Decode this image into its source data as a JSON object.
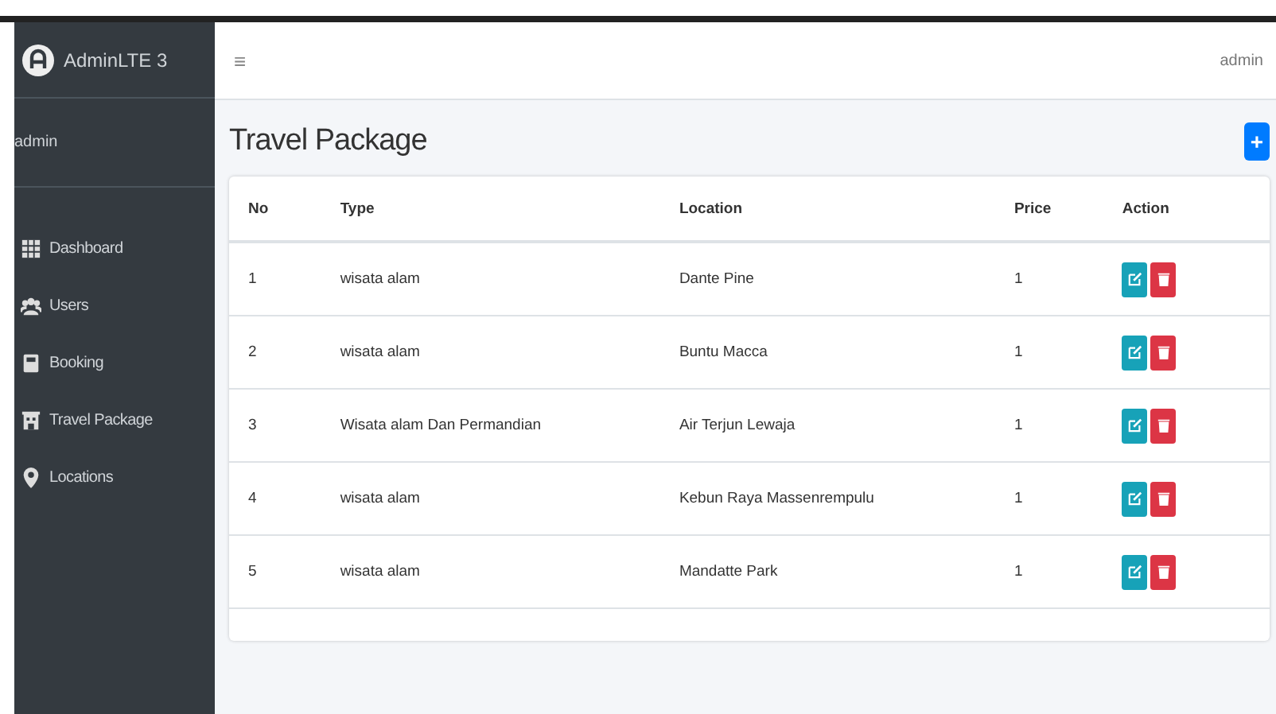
{
  "sidebar": {
    "brand": "AdminLTE 3",
    "user": "admin",
    "items": [
      {
        "label": "Dashboard"
      },
      {
        "label": "Users"
      },
      {
        "label": "Booking"
      },
      {
        "label": "Travel Package"
      },
      {
        "label": "Locations"
      }
    ]
  },
  "navbar": {
    "menu": "≡",
    "user": "admin"
  },
  "page": {
    "title": "Travel Package",
    "add": "+"
  },
  "table": {
    "columns": [
      "No",
      "Type",
      "Location",
      "Price",
      "Action"
    ],
    "rows": [
      {
        "no": "1",
        "type": "wisata alam",
        "location": "Dante Pine",
        "price": "1"
      },
      {
        "no": "2",
        "type": "wisata alam",
        "location": "Buntu Macca",
        "price": "1"
      },
      {
        "no": "3",
        "type": "Wisata alam Dan Permandian",
        "location": "Air Terjun Lewaja",
        "price": "1"
      },
      {
        "no": "4",
        "type": "wisata alam",
        "location": "Kebun Raya Massenrempulu",
        "price": "1"
      },
      {
        "no": "5",
        "type": "wisata alam",
        "location": "Mandatte Park",
        "price": "1"
      }
    ]
  }
}
